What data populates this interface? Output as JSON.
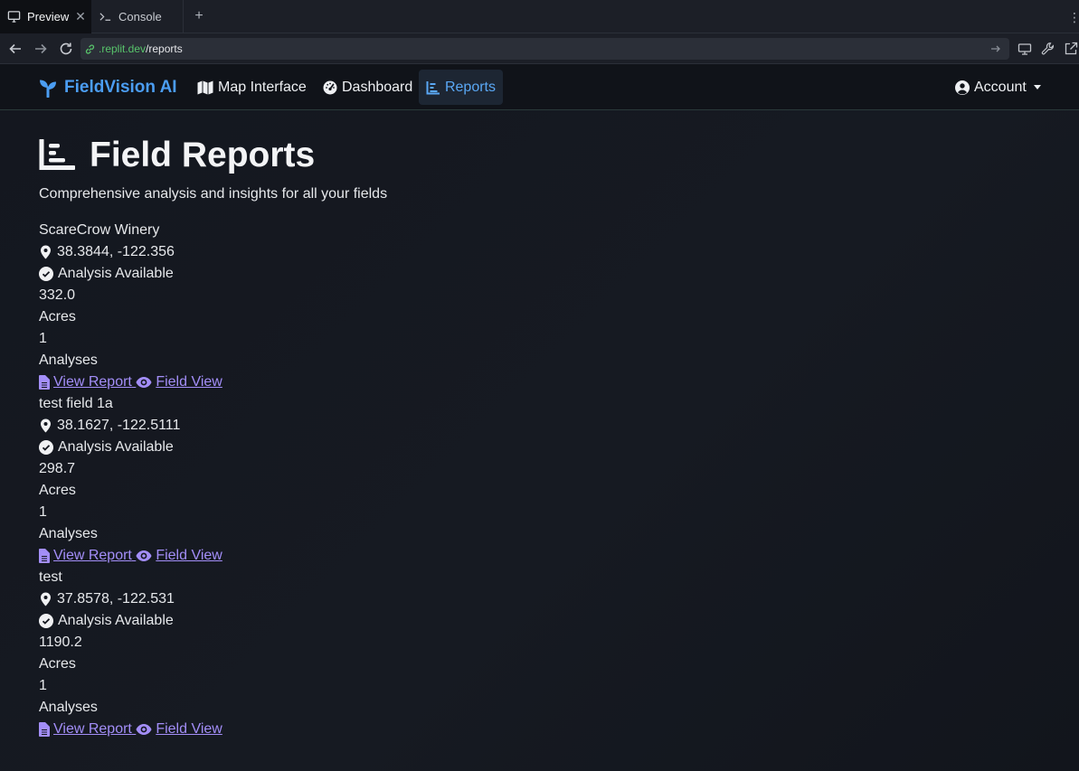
{
  "browser": {
    "tabs": [
      {
        "label": "Preview",
        "active": true
      },
      {
        "label": "Console",
        "active": false
      }
    ],
    "url_host": ".replit.dev",
    "url_path": "/reports"
  },
  "navbar": {
    "brand": "FieldVision AI",
    "links": [
      {
        "label": "Map Interface",
        "icon": "map-icon"
      },
      {
        "label": "Dashboard",
        "icon": "gauge-icon"
      },
      {
        "label": "Reports",
        "icon": "chart-icon",
        "active": true
      }
    ],
    "account_label": "Account"
  },
  "page": {
    "title": "Field Reports",
    "subtitle": "Comprehensive analysis and insights for all your fields"
  },
  "fields": [
    {
      "name": "ScareCrow Winery",
      "coords": "38.3844, -122.356",
      "status": "Analysis Available",
      "acres_value": "332.0",
      "acres_label": "Acres",
      "analyses_value": "1",
      "analyses_label": "Analyses",
      "view_report": "View Report",
      "field_view": "Field View"
    },
    {
      "name": "test field 1a",
      "coords": "38.1627, -122.5111",
      "status": "Analysis Available",
      "acres_value": "298.7",
      "acres_label": "Acres",
      "analyses_value": "1",
      "analyses_label": "Analyses",
      "view_report": "View Report",
      "field_view": "Field View"
    },
    {
      "name": "test",
      "coords": "37.8578, -122.531",
      "status": "Analysis Available",
      "acres_value": "1190.2",
      "acres_label": "Acres",
      "analyses_value": "1",
      "analyses_label": "Analyses",
      "view_report": "View Report",
      "field_view": "Field View"
    }
  ],
  "colors": {
    "brand": "#4b9df2",
    "link": "#a38ef8",
    "active_nav": "#5aa8f5",
    "url_host": "#58c46b"
  }
}
